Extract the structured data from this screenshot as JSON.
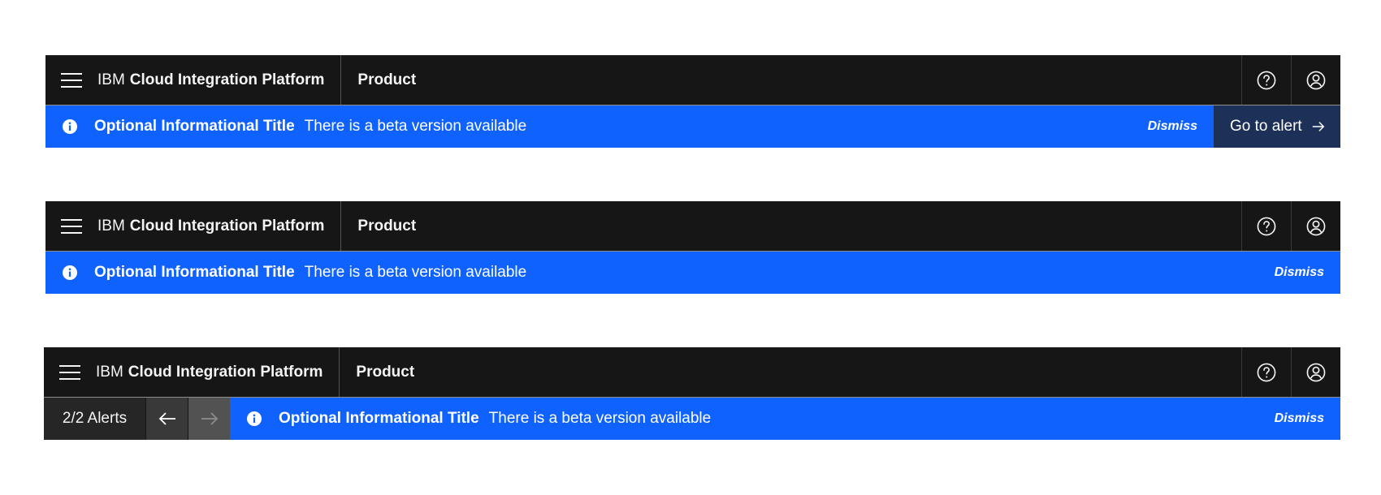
{
  "header": {
    "brand_prefix": "IBM",
    "brand_name": "Cloud Integration Platform",
    "product": "Product",
    "icons": [
      "help-icon",
      "user-avatar-icon"
    ]
  },
  "notification": {
    "title": "Optional Informational Title",
    "message": "There is a beta version available",
    "dismiss_label": "Dismiss",
    "action_label": "Go to alert"
  },
  "pager": {
    "count_label": "2/2 Alerts"
  },
  "colors": {
    "header_bg": "#161616",
    "notification_bg": "#0f62fe",
    "action_bg": "#1c3058",
    "pager_bg": "#262626"
  }
}
